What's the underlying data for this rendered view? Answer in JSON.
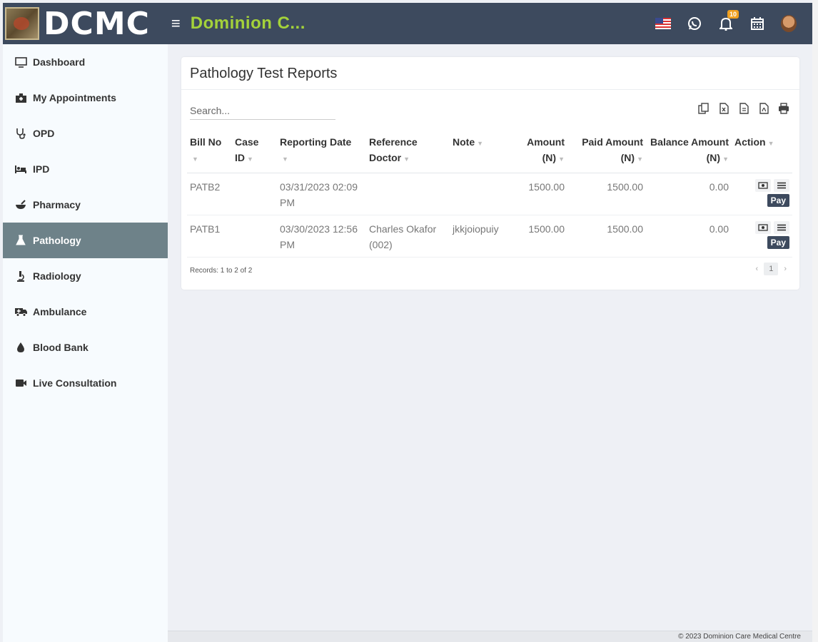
{
  "header": {
    "logo_text": "DCMC",
    "hamburger": "≡",
    "brand": "Dominion C...",
    "notification_count": "10"
  },
  "sidebar": {
    "items": [
      {
        "label": "Dashboard",
        "icon": "monitor-icon"
      },
      {
        "label": "My Appointments",
        "icon": "hospital-icon"
      },
      {
        "label": "OPD",
        "icon": "stethoscope-icon"
      },
      {
        "label": "IPD",
        "icon": "bed-icon"
      },
      {
        "label": "Pharmacy",
        "icon": "mortar-pestle-icon"
      },
      {
        "label": "Pathology",
        "icon": "flask-icon",
        "active": true
      },
      {
        "label": "Radiology",
        "icon": "microscope-icon"
      },
      {
        "label": "Ambulance",
        "icon": "ambulance-icon"
      },
      {
        "label": "Blood Bank",
        "icon": "blood-drop-icon"
      },
      {
        "label": "Live Consultation",
        "icon": "video-camera-icon"
      }
    ]
  },
  "main": {
    "title": "Pathology Test Reports",
    "search_placeholder": "Search...",
    "columns": {
      "bill_no": "Bill No",
      "case_id": "Case ID",
      "reporting_date": "Reporting Date",
      "reference_doctor": "Reference Doctor",
      "note": "Note",
      "amount": "Amount (N)",
      "paid_amount": "Paid Amount (N)",
      "balance_amount": "Balance Amount (N)",
      "action": "Action"
    },
    "rows": [
      {
        "bill_no": "PATB2",
        "case_id": "",
        "reporting_date": "03/31/2023 02:09 PM",
        "reference_doctor": "",
        "note": "",
        "amount": "1500.00",
        "paid_amount": "1500.00",
        "balance_amount": "0.00",
        "pay_label": "Pay"
      },
      {
        "bill_no": "PATB1",
        "case_id": "",
        "reporting_date": "03/30/2023 12:56 PM",
        "reference_doctor": "Charles Okafor (002)",
        "note": "jkkjoiopuiy",
        "amount": "1500.00",
        "paid_amount": "1500.00",
        "balance_amount": "0.00",
        "pay_label": "Pay"
      }
    ],
    "records_text": "Records: 1 to 2 of 2",
    "pager": {
      "prev": "‹",
      "current": "1",
      "next": "›"
    }
  },
  "footer": {
    "text": "© 2023 Dominion Care Medical Centre"
  },
  "colors": {
    "topbar": "#3d4a5e",
    "brand": "#a4d23a",
    "active_nav": "#6e8289",
    "badge": "#f0a020"
  }
}
